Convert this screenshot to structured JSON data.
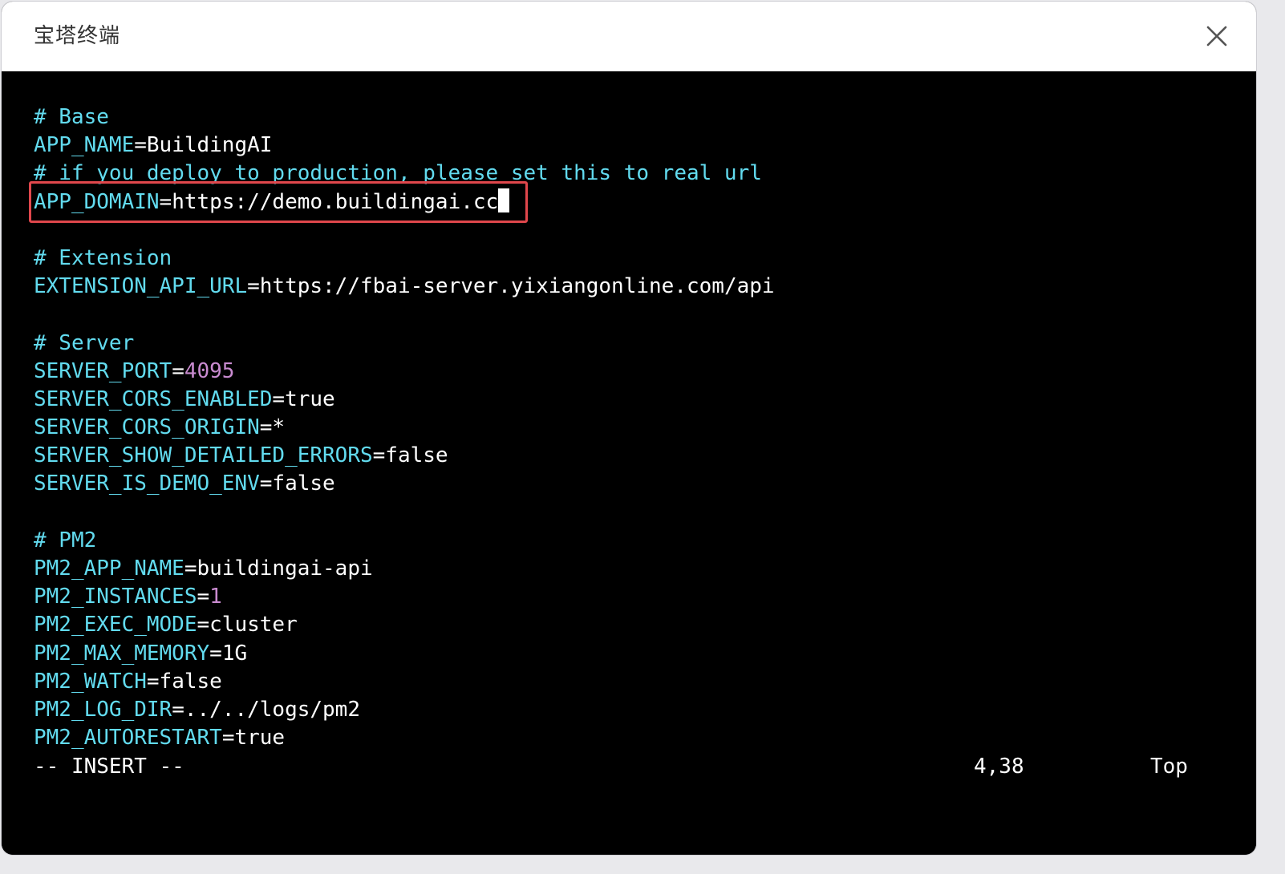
{
  "window": {
    "title": "宝塔终端"
  },
  "colors": {
    "comment": "#62dbef",
    "key": "#62dbef",
    "text": "#ffffff",
    "number": "#c98bd0",
    "highlight": "#e0474c",
    "background": "#000000"
  },
  "editor": {
    "lines": [
      {
        "type": "comment",
        "text": "# Base"
      },
      {
        "type": "kv",
        "key": "APP_NAME",
        "value": "BuildingAI",
        "value_type": "string"
      },
      {
        "type": "comment",
        "text": "# if you deploy to production, please set this to real url"
      },
      {
        "type": "kv",
        "key": "APP_DOMAIN",
        "value": "https://demo.buildingai.cc",
        "value_type": "string",
        "cursor": true
      },
      {
        "type": "blank"
      },
      {
        "type": "comment",
        "text": "# Extension"
      },
      {
        "type": "kv",
        "key": "EXTENSION_API_URL",
        "value": "https://fbai-server.yixiangonline.com/api",
        "value_type": "string"
      },
      {
        "type": "blank"
      },
      {
        "type": "comment",
        "text": "# Server"
      },
      {
        "type": "kv",
        "key": "SERVER_PORT",
        "value": "4095",
        "value_type": "number"
      },
      {
        "type": "kv",
        "key": "SERVER_CORS_ENABLED",
        "value": "true",
        "value_type": "string"
      },
      {
        "type": "kv",
        "key": "SERVER_CORS_ORIGIN",
        "value": "*",
        "value_type": "string"
      },
      {
        "type": "kv",
        "key": "SERVER_SHOW_DETAILED_ERRORS",
        "value": "false",
        "value_type": "string"
      },
      {
        "type": "kv",
        "key": "SERVER_IS_DEMO_ENV",
        "value": "false",
        "value_type": "string"
      },
      {
        "type": "blank"
      },
      {
        "type": "comment",
        "text": "# PM2"
      },
      {
        "type": "kv",
        "key": "PM2_APP_NAME",
        "value": "buildingai-api",
        "value_type": "string"
      },
      {
        "type": "kv",
        "key": "PM2_INSTANCES",
        "value": "1",
        "value_type": "number"
      },
      {
        "type": "kv",
        "key": "PM2_EXEC_MODE",
        "value": "cluster",
        "value_type": "string"
      },
      {
        "type": "kv",
        "key": "PM2_MAX_MEMORY",
        "value": "1G",
        "value_type": "string"
      },
      {
        "type": "kv",
        "key": "PM2_WATCH",
        "value": "false",
        "value_type": "string"
      },
      {
        "type": "kv",
        "key": "PM2_LOG_DIR",
        "value": "../../logs/pm2",
        "value_type": "string"
      },
      {
        "type": "kv",
        "key": "PM2_AUTORESTART",
        "value": "true",
        "value_type": "string"
      }
    ]
  },
  "statusbar": {
    "mode": "-- INSERT --",
    "position": "4,38",
    "scroll": "Top"
  },
  "icons": {
    "close": "close-icon"
  }
}
